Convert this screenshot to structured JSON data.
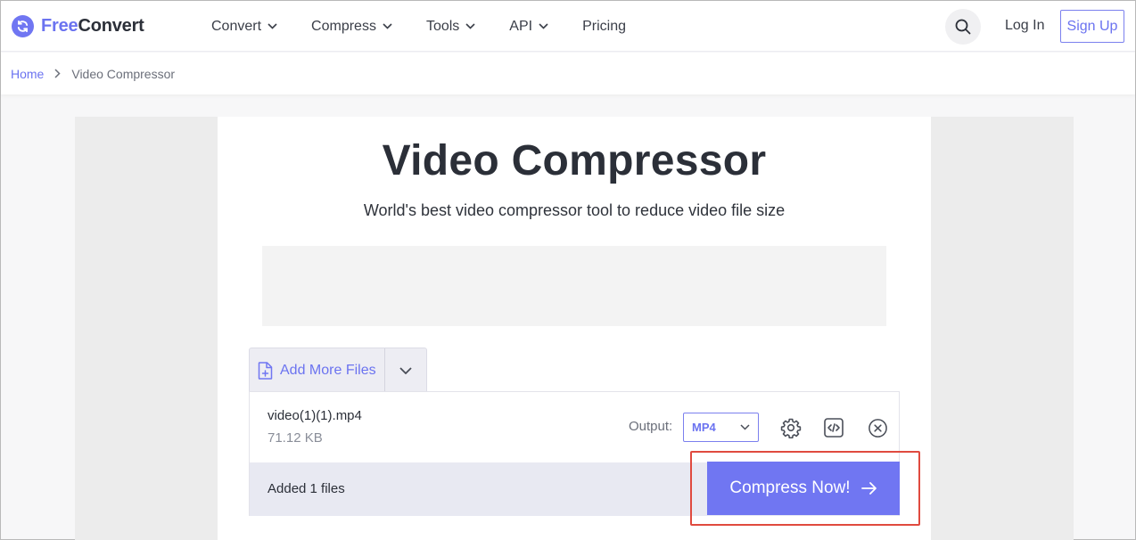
{
  "brand": {
    "name_part1": "Free",
    "name_part2": "Convert",
    "accent": "#6b73f0"
  },
  "nav": {
    "items": [
      {
        "label": "Convert",
        "has_dropdown": true
      },
      {
        "label": "Compress",
        "has_dropdown": true
      },
      {
        "label": "Tools",
        "has_dropdown": true
      },
      {
        "label": "API",
        "has_dropdown": true
      },
      {
        "label": "Pricing",
        "has_dropdown": false
      }
    ],
    "search_icon": "search-icon",
    "login_label": "Log In",
    "signup_label": "Sign Up"
  },
  "breadcrumb": {
    "home": "Home",
    "current": "Video Compressor"
  },
  "page": {
    "title": "Video Compressor",
    "subtitle": "World's best video compressor tool to reduce video file size"
  },
  "upload": {
    "add_more_label": "Add More Files",
    "file": {
      "name": "video(1)(1).mp4",
      "size": "71.12 KB"
    },
    "output_label": "Output:",
    "output_value": "MP4",
    "added_text": "Added 1 files",
    "compress_label": "Compress Now!",
    "highlight_color": "#e04a3f"
  }
}
